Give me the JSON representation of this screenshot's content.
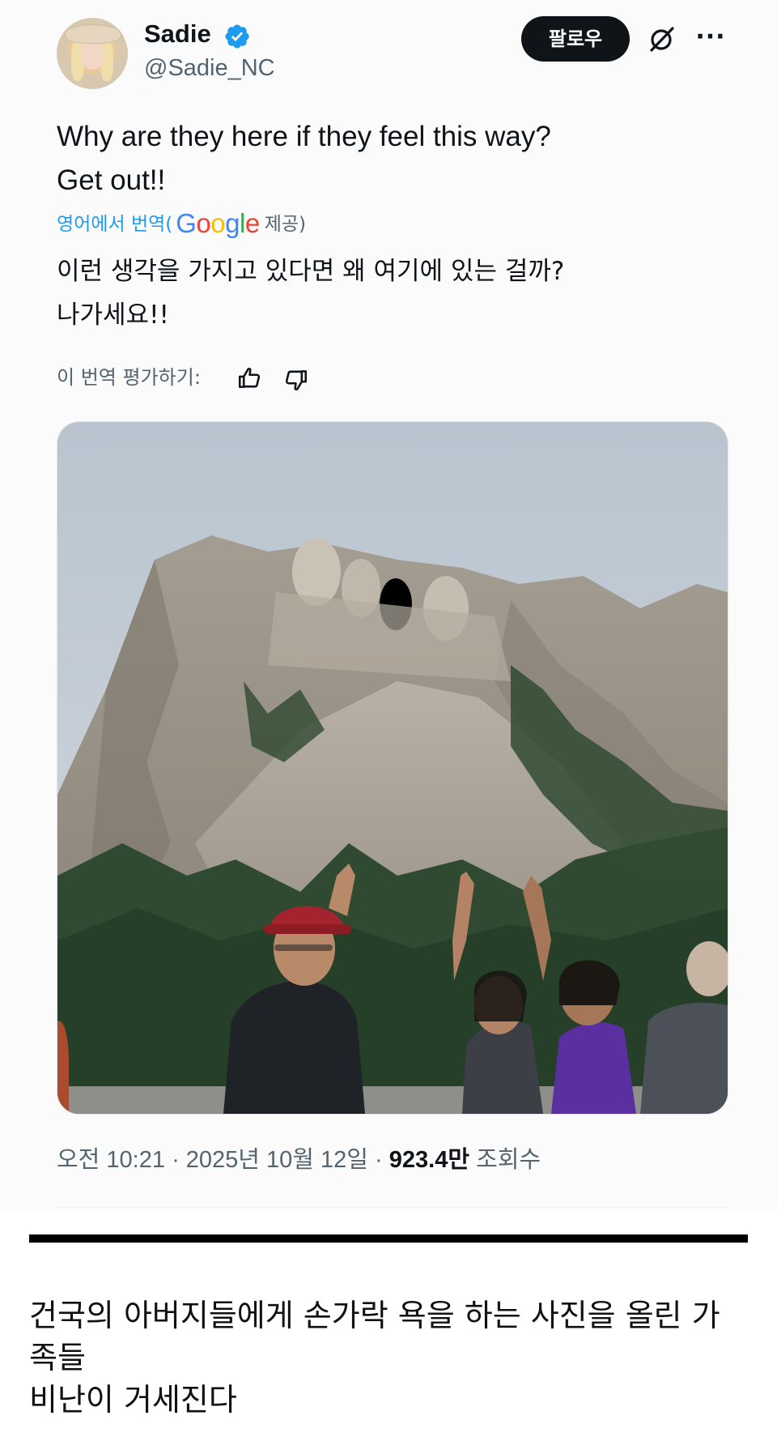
{
  "tweet": {
    "author": {
      "display_name": "Sadie",
      "handle": "@Sadie_NC",
      "verified": true
    },
    "follow_label": "팔로우",
    "text_lines": [
      "Why are they here if they feel this way?",
      "Get out!!"
    ],
    "translation": {
      "from_label": "영어에서 번역(",
      "provider": "Google",
      "provided_label": "제공)"
    },
    "translated_lines": [
      "이런 생각을 가지고 있다면 왜 여기에 있는 걸까?",
      "나가세요!!"
    ],
    "rate_label": "이 번역 평가하기:",
    "meta": {
      "time": "오전 10:21",
      "date": "2025년 10월 12일",
      "views_count": "923.4만",
      "views_label": "조회수",
      "separator": "·"
    }
  },
  "caption_lines": [
    "건국의 아버지들에게 손가락 욕을 하는 사진을 올린 가",
    "족들",
    "비난이 거세진다"
  ],
  "icons": {
    "verified": "verified-badge-icon",
    "grok": "grok-icon",
    "more": "more-icon",
    "thumbs_up": "thumbs-up-icon",
    "thumbs_down": "thumbs-down-icon"
  },
  "colors": {
    "text": "#0f1419",
    "secondary": "#536471",
    "link": "#1d9bf0",
    "verified": "#1d9bf0",
    "follow_bg": "#0f1419"
  }
}
